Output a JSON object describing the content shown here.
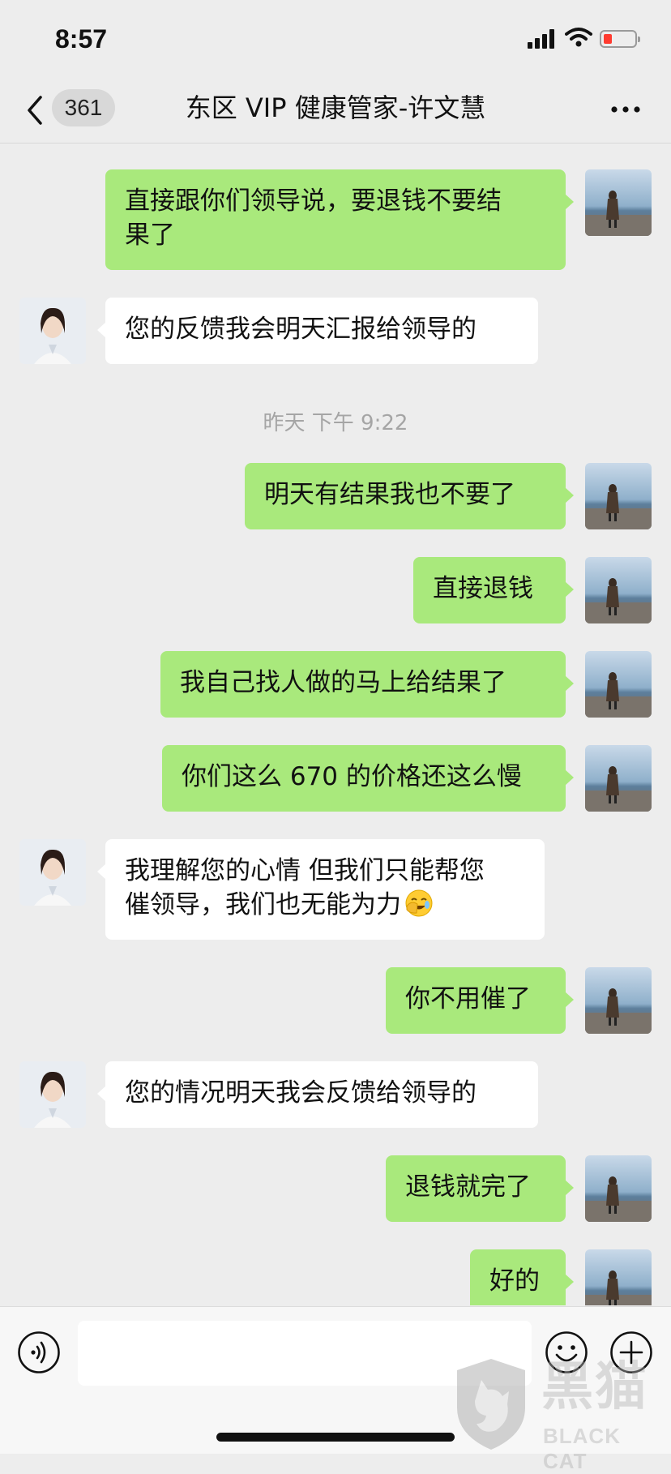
{
  "status_bar": {
    "time": "8:57"
  },
  "nav": {
    "unread_count": "361",
    "title": "东区 VIP 健康管家-许文慧"
  },
  "messages": [
    {
      "sender": "me",
      "text_line1": "直接跟你们领导说，要退钱不要结",
      "text_line2": "果了"
    },
    {
      "sender": "them",
      "text": "您的反馈我会明天汇报给领导的"
    },
    {
      "sender": "me",
      "text": "明天有结果我也不要了"
    },
    {
      "sender": "me",
      "text": "直接退钱"
    },
    {
      "sender": "me",
      "text": "我自己找人做的马上给结果了"
    },
    {
      "sender": "me",
      "text": "你们这么 670 的价格还这么慢"
    },
    {
      "sender": "them",
      "text_line1": "我理解您的心情 但我们只能帮您",
      "text_line2": "催领导，我们也无能为力",
      "emoji": "facepalm-emoji"
    },
    {
      "sender": "me",
      "text": "你不用催了"
    },
    {
      "sender": "them",
      "text": "您的情况明天我会反馈给领导的"
    },
    {
      "sender": "me",
      "text": "退钱就完了"
    },
    {
      "sender": "me",
      "text": "好的"
    }
  ],
  "timestamp": "昨天  下午 9:22",
  "input_bar": {
    "input_value": "",
    "icons": [
      "voice-icon",
      "emoji-icon",
      "plus-icon"
    ]
  },
  "watermark": {
    "logo_text_cn": "黑猫",
    "logo_text_en": "BLACK CAT"
  },
  "colors": {
    "background": "#ededed",
    "my_bubble": "#a9e97c",
    "their_bubble": "#ffffff",
    "timestamp_text": "#a5a5a5",
    "battery_low": "#ff3b30"
  }
}
